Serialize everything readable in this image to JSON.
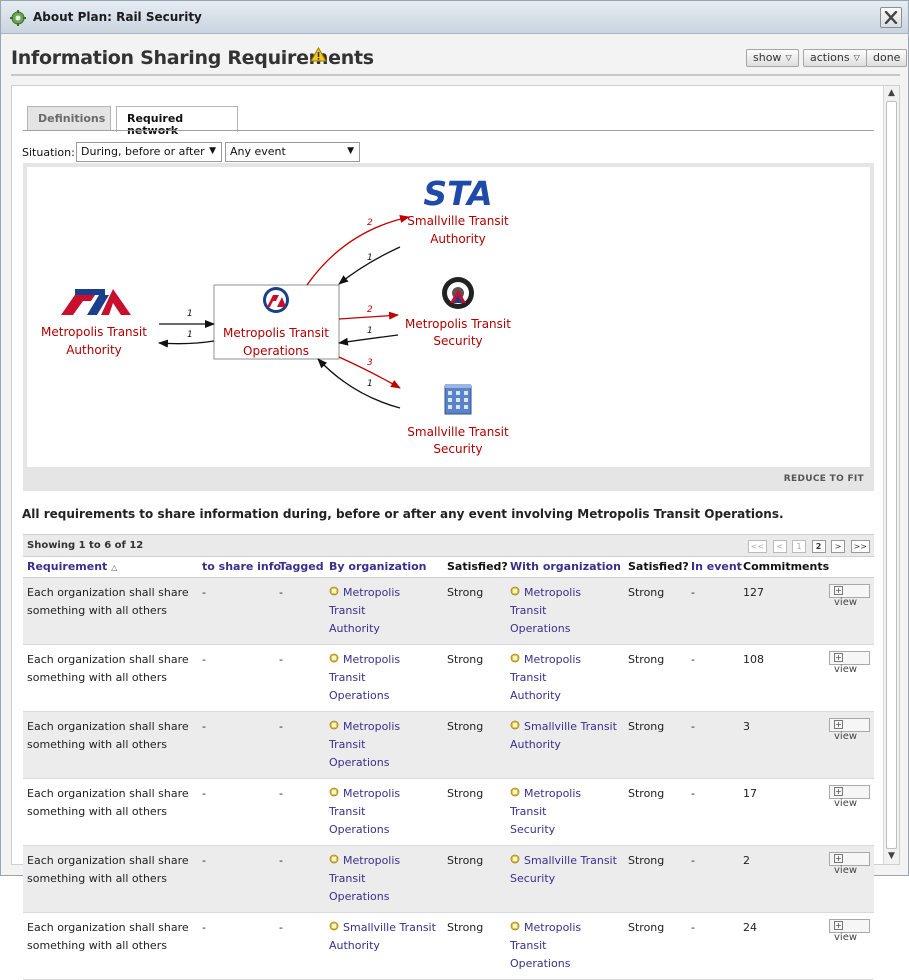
{
  "window": {
    "title": "About Plan: Rail Security"
  },
  "header": {
    "title": "Information Sharing Requirements",
    "show_label": "show",
    "actions_label": "actions",
    "done_label": "done"
  },
  "tabs": [
    {
      "label": "Definitions"
    },
    {
      "label": "Required network"
    }
  ],
  "situation": {
    "label": "Situation:",
    "timing": "During, before or after",
    "event": "Any event"
  },
  "diagram": {
    "reduce_label": "REDUCE TO FIT",
    "nodes": {
      "mta": {
        "line1": "Metropolis Transit",
        "line2": "Authority"
      },
      "mto": {
        "line1": "Metropolis Transit",
        "line2": "Operations"
      },
      "sta": {
        "logo": "STA",
        "line1": "Smallville Transit",
        "line2": "Authority"
      },
      "mts": {
        "line1": "Metropolis Transit",
        "line2": "Security"
      },
      "sts": {
        "line1": "Smallville Transit",
        "line2": "Security"
      }
    },
    "edges": {
      "mta_to_mto": "1",
      "mto_to_mta": "1",
      "mto_to_sta": "2",
      "sta_to_mto": "1",
      "mto_to_mts": "2",
      "mts_to_mto": "1",
      "mto_to_sts": "3",
      "sts_to_mto": "1"
    },
    "colors": {
      "required": "#c00000",
      "offered": "#111111",
      "label": "#b00000"
    }
  },
  "summary": "All requirements to share information during, before or after any event involving Metropolis Transit Operations.",
  "table": {
    "showing": "Showing 1 to 6 of 12",
    "pager": {
      "first": "<<",
      "prev": "<",
      "page1": "1",
      "page2": "2",
      "next": ">",
      "last": ">>"
    },
    "columns": {
      "requirement": "Requirement",
      "to_share": "to share info",
      "tagged": "Tagged",
      "by_org": "By organization",
      "satisfied1": "Satisfied?",
      "with_org": "With organization",
      "satisfied2": "Satisfied?",
      "in_event": "In event",
      "commitments": "Commitments"
    },
    "view_label": "view",
    "rows": [
      {
        "req1": "Each organization shall share",
        "req2": "something with all others",
        "share": "-",
        "tagged": "-",
        "by1": "Metropolis Transit",
        "by2": "Authority",
        "sat1": "Strong",
        "with1": "Metropolis Transit",
        "with2": "Operations",
        "sat2": "Strong",
        "event": "-",
        "commit": "127"
      },
      {
        "req1": "Each organization shall share",
        "req2": "something with all others",
        "share": "-",
        "tagged": "-",
        "by1": "Metropolis Transit",
        "by2": "Operations",
        "sat1": "Strong",
        "with1": "Metropolis Transit",
        "with2": "Authority",
        "sat2": "Strong",
        "event": "-",
        "commit": "108"
      },
      {
        "req1": "Each organization shall share",
        "req2": "something with all others",
        "share": "-",
        "tagged": "-",
        "by1": "Metropolis Transit",
        "by2": "Operations",
        "sat1": "Strong",
        "with1": "Smallville Transit",
        "with2": "Authority",
        "sat2": "Strong",
        "event": "-",
        "commit": "3"
      },
      {
        "req1": "Each organization shall share",
        "req2": "something with all others",
        "share": "-",
        "tagged": "-",
        "by1": "Metropolis Transit",
        "by2": "Operations",
        "sat1": "Strong",
        "with1": "Metropolis Transit",
        "with2": "Security",
        "sat2": "Strong",
        "event": "-",
        "commit": "17"
      },
      {
        "req1": "Each organization shall share",
        "req2": "something with all others",
        "share": "-",
        "tagged": "-",
        "by1": "Metropolis Transit",
        "by2": "Operations",
        "sat1": "Strong",
        "with1": "Smallville Transit",
        "with2": "Security",
        "sat2": "Strong",
        "event": "-",
        "commit": "2"
      },
      {
        "req1": "Each organization shall share",
        "req2": "something with all others",
        "share": "-",
        "tagged": "-",
        "by1": "Smallville Transit",
        "by2": "Authority",
        "sat1": "Strong",
        "with1": "Metropolis Transit",
        "with2": "Operations",
        "sat2": "Strong",
        "event": "-",
        "commit": "24"
      }
    ]
  }
}
